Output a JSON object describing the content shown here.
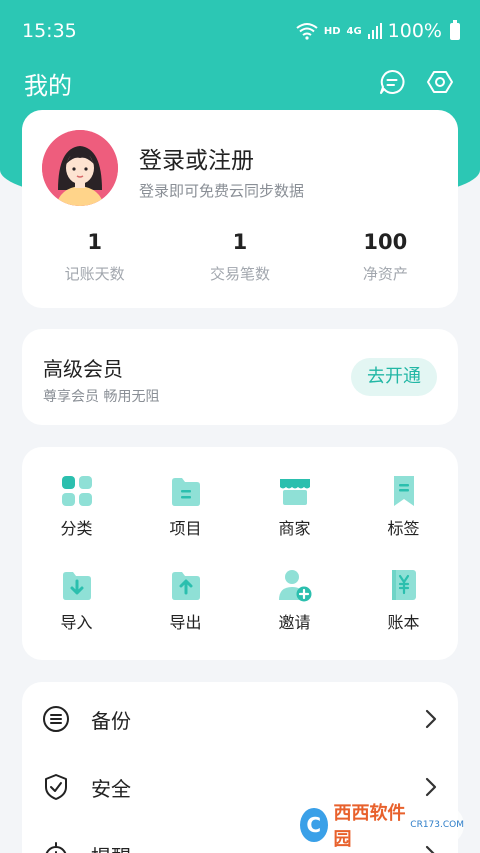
{
  "status_bar": {
    "time": "15:35",
    "network_hd": "HD",
    "network_4g": "4G",
    "battery": "100%"
  },
  "header": {
    "title": "我的"
  },
  "profile": {
    "title": "登录或注册",
    "subtitle": "登录即可免费云同步数据",
    "stats": [
      {
        "value": "1",
        "label": "记账天数"
      },
      {
        "value": "1",
        "label": "交易笔数"
      },
      {
        "value": "100",
        "label": "净资产"
      }
    ]
  },
  "vip": {
    "title": "高级会员",
    "subtitle": "尊享会员 畅用无阻",
    "button": "去开通"
  },
  "grid": {
    "items": [
      {
        "label": "分类",
        "icon": "category-icon"
      },
      {
        "label": "项目",
        "icon": "project-icon"
      },
      {
        "label": "商家",
        "icon": "merchant-icon"
      },
      {
        "label": "标签",
        "icon": "tag-icon"
      },
      {
        "label": "导入",
        "icon": "import-icon"
      },
      {
        "label": "导出",
        "icon": "export-icon"
      },
      {
        "label": "邀请",
        "icon": "invite-icon"
      },
      {
        "label": "账本",
        "icon": "ledger-icon"
      }
    ]
  },
  "list": {
    "items": [
      {
        "label": "备份",
        "icon": "backup-icon"
      },
      {
        "label": "安全",
        "icon": "security-icon"
      },
      {
        "label": "提醒",
        "icon": "reminder-icon"
      }
    ]
  },
  "watermark": {
    "text": "西西软件园",
    "url": "CR173.COM"
  },
  "colors": {
    "accent": "#2cc7b4",
    "icon_light": "#8fe0d6",
    "icon_dark": "#2bbfae",
    "background": "#f3f5f8"
  }
}
